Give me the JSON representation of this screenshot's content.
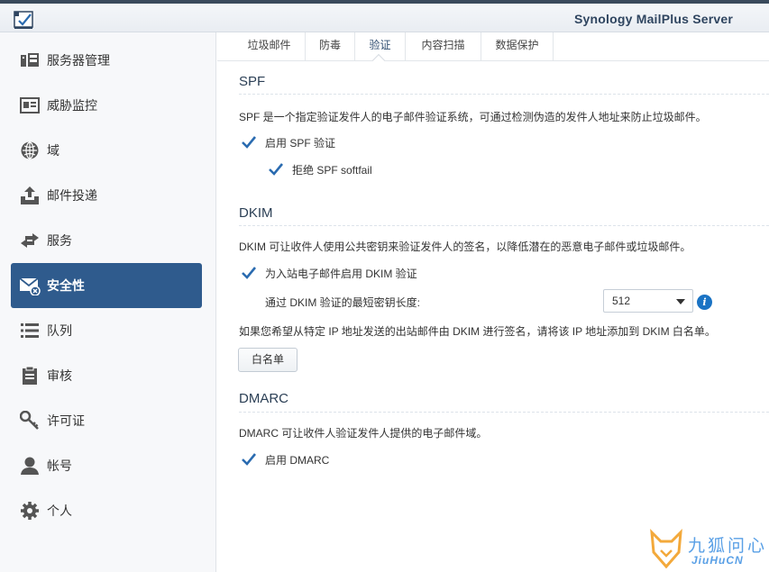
{
  "app": {
    "title": "Synology MailPlus Server"
  },
  "sidebar": {
    "items": [
      {
        "label": "服务器管理",
        "icon": "server-icon",
        "active": false
      },
      {
        "label": "威胁监控",
        "icon": "monitor-card-icon",
        "active": false
      },
      {
        "label": "域",
        "icon": "globe-icon",
        "active": false
      },
      {
        "label": "邮件投递",
        "icon": "upload-tray-icon",
        "active": false
      },
      {
        "label": "服务",
        "icon": "arrows-exchange-icon",
        "active": false
      },
      {
        "label": "安全性",
        "icon": "mail-security-icon",
        "active": true
      },
      {
        "label": "队列",
        "icon": "list-icon",
        "active": false
      },
      {
        "label": "审核",
        "icon": "clipboard-icon",
        "active": false
      },
      {
        "label": "许可证",
        "icon": "key-icon",
        "active": false
      },
      {
        "label": "帐号",
        "icon": "user-icon",
        "active": false
      },
      {
        "label": "个人",
        "icon": "gear-icon",
        "active": false
      }
    ]
  },
  "tabs": [
    {
      "label": "垃圾邮件",
      "active": false
    },
    {
      "label": "防毒",
      "active": false
    },
    {
      "label": "验证",
      "active": true
    },
    {
      "label": "内容扫描",
      "active": false
    },
    {
      "label": "数据保护",
      "active": false
    }
  ],
  "spf": {
    "title": "SPF",
    "description": "SPF 是一个指定验证发件人的电子邮件验证系统，可通过检测伪造的发件人地址来防止垃圾邮件。",
    "enable_label": "启用 SPF 验证",
    "enable_checked": true,
    "reject_label": "拒绝 SPF softfail",
    "reject_checked": true
  },
  "dkim": {
    "title": "DKIM",
    "description": "DKIM 可让收件人使用公共密钥来验证发件人的签名，以降低潜在的恶意电子邮件或垃圾邮件。",
    "enable_label": "为入站电子邮件启用 DKIM 验证",
    "enable_checked": true,
    "min_key_label": "通过 DKIM 验证的最短密钥长度:",
    "min_key_value": "512",
    "whitelist_hint": "如果您希望从特定 IP 地址发送的出站邮件由 DKIM 进行签名，请将该 IP 地址添加到 DKIM 白名单。",
    "whitelist_button": "白名单"
  },
  "dmarc": {
    "title": "DMARC",
    "description": "DMARC 可让收件人验证发件人提供的电子邮件域。",
    "enable_label": "启用 DMARC",
    "enable_checked": true
  },
  "watermark": {
    "text_cn": "九狐问心",
    "text_en": "JiuHuCN"
  },
  "colors": {
    "accent": "#2f5b8d",
    "check": "#2a6bb0",
    "info": "#1a73c4",
    "title": "#2f4560"
  }
}
